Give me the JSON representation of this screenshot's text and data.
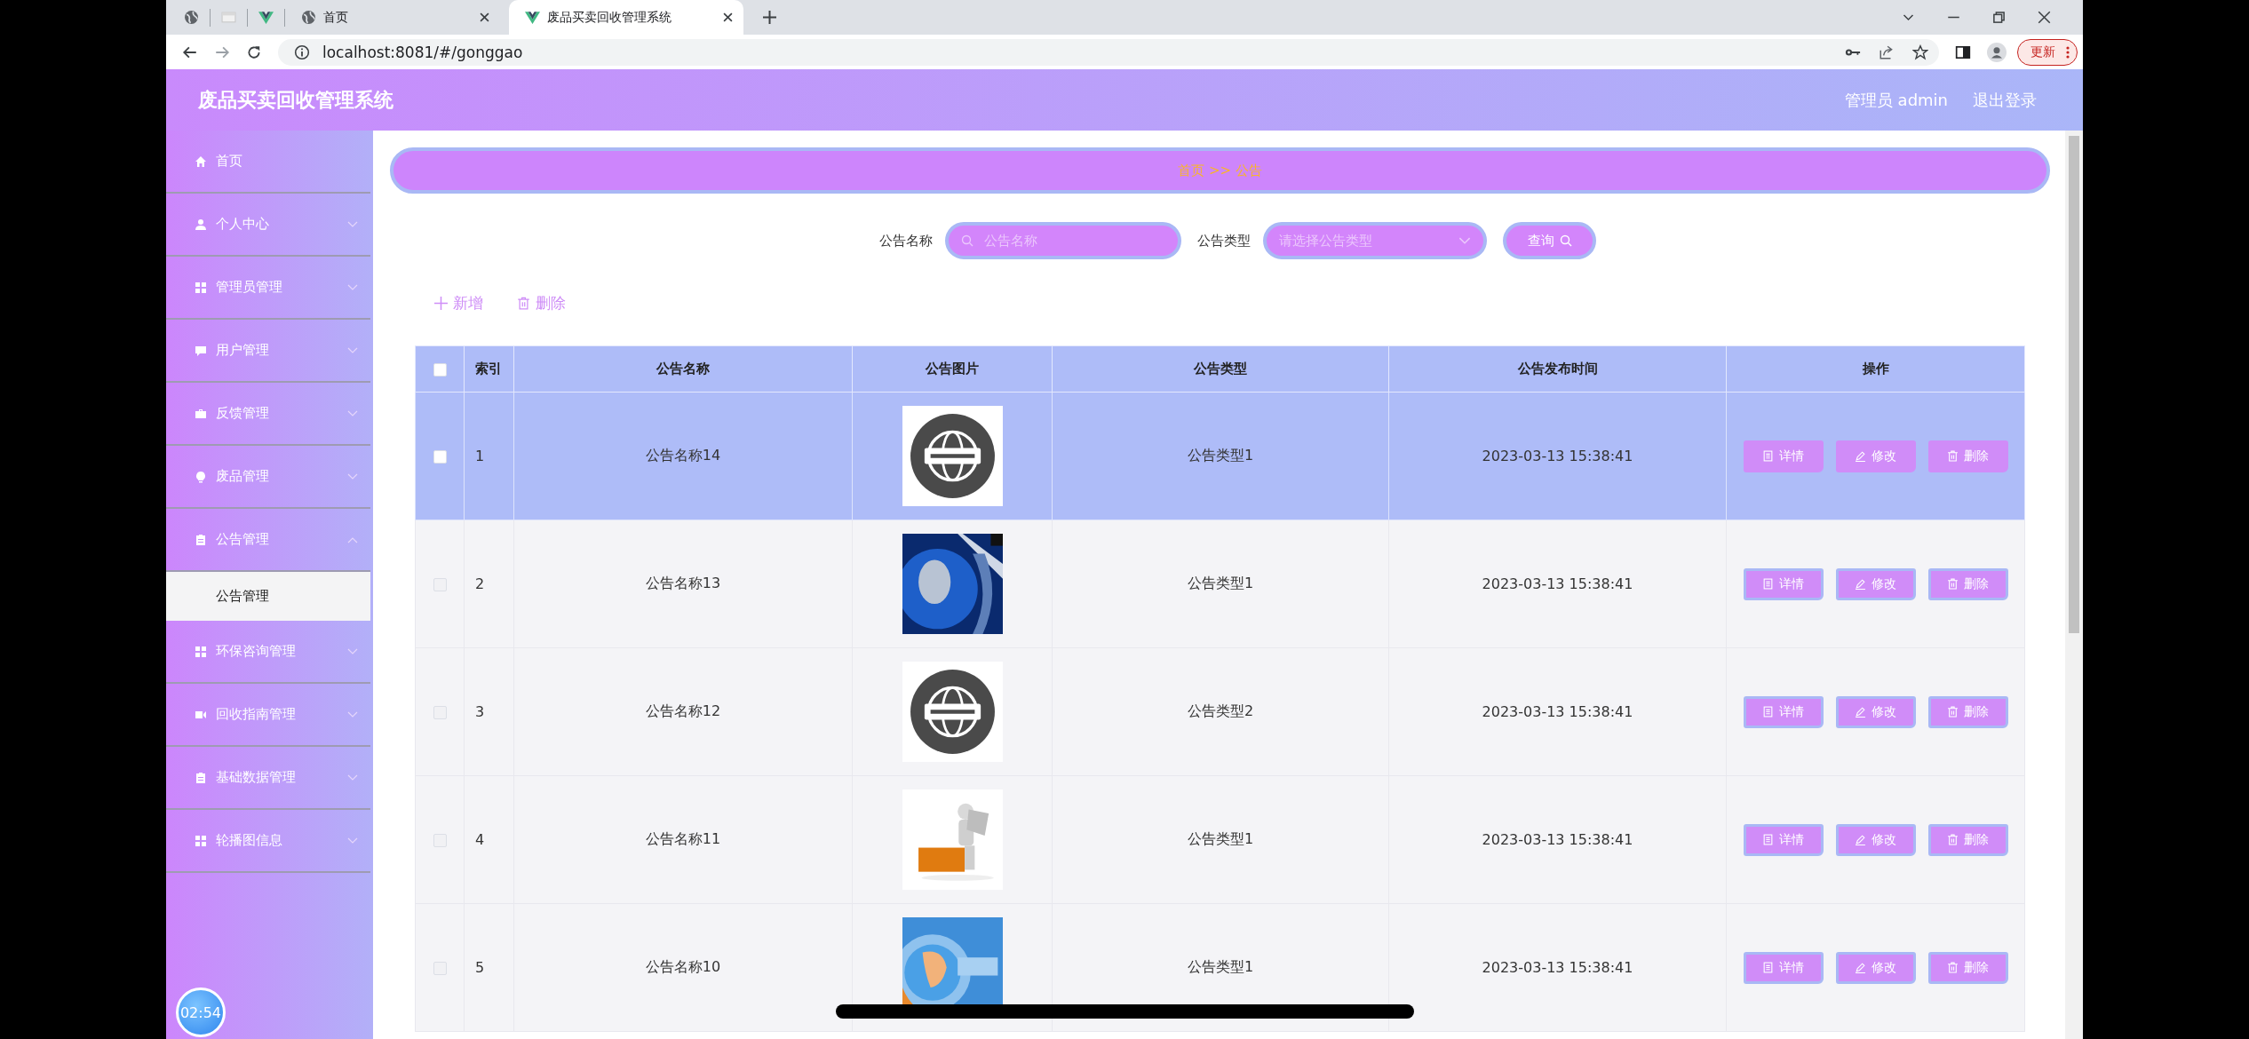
{
  "browser": {
    "tabs": [
      {
        "title": "首页",
        "selected": false
      },
      {
        "title": "废品买卖回收管理系统",
        "selected": true
      }
    ],
    "address": "localhost:8081/#/gonggao",
    "update_button": "更新"
  },
  "header": {
    "title": "废品买卖回收管理系统",
    "user": "管理员 admin",
    "logout": "退出登录"
  },
  "sidebar": {
    "items": [
      {
        "label": "首页",
        "kind": "home"
      },
      {
        "label": "个人中心",
        "kind": "person",
        "expanded": false
      },
      {
        "label": "管理员管理",
        "kind": "grid",
        "expanded": false
      },
      {
        "label": "用户管理",
        "kind": "chat",
        "expanded": false
      },
      {
        "label": "反馈管理",
        "kind": "bag",
        "expanded": false
      },
      {
        "label": "废品管理",
        "kind": "bulb",
        "expanded": false
      },
      {
        "label": "公告管理",
        "kind": "clipboard",
        "expanded": true,
        "children": [
          {
            "label": "公告管理",
            "selected": true
          }
        ]
      },
      {
        "label": "环保咨询管理",
        "kind": "grid",
        "expanded": false
      },
      {
        "label": "回收指南管理",
        "kind": "video",
        "expanded": false
      },
      {
        "label": "基础数据管理",
        "kind": "clipboard",
        "expanded": false
      },
      {
        "label": "轮播图信息",
        "kind": "grid",
        "expanded": false
      }
    ]
  },
  "breadcrumb": "首页 >> 公告",
  "search": {
    "fields": [
      {
        "label": "公告名称",
        "kind": "input",
        "placeholder": "公告名称"
      },
      {
        "label": "公告类型",
        "kind": "select",
        "placeholder": "请选择公告类型"
      }
    ],
    "button": "查询"
  },
  "actions": [
    {
      "label": "新增",
      "kind": "add"
    },
    {
      "label": "删除",
      "kind": "delete"
    }
  ],
  "table": {
    "all_checked": false,
    "columns": [
      "索引",
      "公告名称",
      "公告图片",
      "公告类型",
      "公告发布时间",
      "操作"
    ],
    "rows": [
      {
        "selected": true,
        "checked": false,
        "index": "1",
        "name": "公告名称14",
        "type": "公告类型1",
        "time": "2023-03-13 15:38:41",
        "actions": [
          {
            "label": "详情",
            "kind": "detail"
          },
          {
            "label": "修改",
            "kind": "edit"
          },
          {
            "label": "删除",
            "kind": "delete"
          }
        ]
      },
      {
        "selected": false,
        "checked": false,
        "index": "2",
        "name": "公告名称13",
        "type": "公告类型1",
        "time": "2023-03-13 15:38:41",
        "actions": [
          {
            "label": "详情",
            "kind": "detail"
          },
          {
            "label": "修改",
            "kind": "edit"
          },
          {
            "label": "删除",
            "kind": "delete"
          }
        ]
      },
      {
        "selected": false,
        "checked": false,
        "index": "3",
        "name": "公告名称12",
        "type": "公告类型2",
        "time": "2023-03-13 15:38:41",
        "actions": [
          {
            "label": "详情",
            "kind": "detail"
          },
          {
            "label": "修改",
            "kind": "edit"
          },
          {
            "label": "删除",
            "kind": "delete"
          }
        ]
      },
      {
        "selected": false,
        "checked": false,
        "index": "4",
        "name": "公告名称11",
        "type": "公告类型1",
        "time": "2023-03-13 15:38:41",
        "actions": [
          {
            "label": "详情",
            "kind": "detail"
          },
          {
            "label": "修改",
            "kind": "edit"
          },
          {
            "label": "删除",
            "kind": "delete"
          }
        ]
      },
      {
        "selected": false,
        "checked": false,
        "index": "5",
        "name": "公告名称10",
        "type": "公告类型1",
        "time": "2023-03-13 15:38:41",
        "actions": [
          {
            "label": "详情",
            "kind": "detail"
          },
          {
            "label": "修改",
            "kind": "edit"
          },
          {
            "label": "删除",
            "kind": "delete"
          }
        ]
      }
    ]
  },
  "timer": "02:54"
}
